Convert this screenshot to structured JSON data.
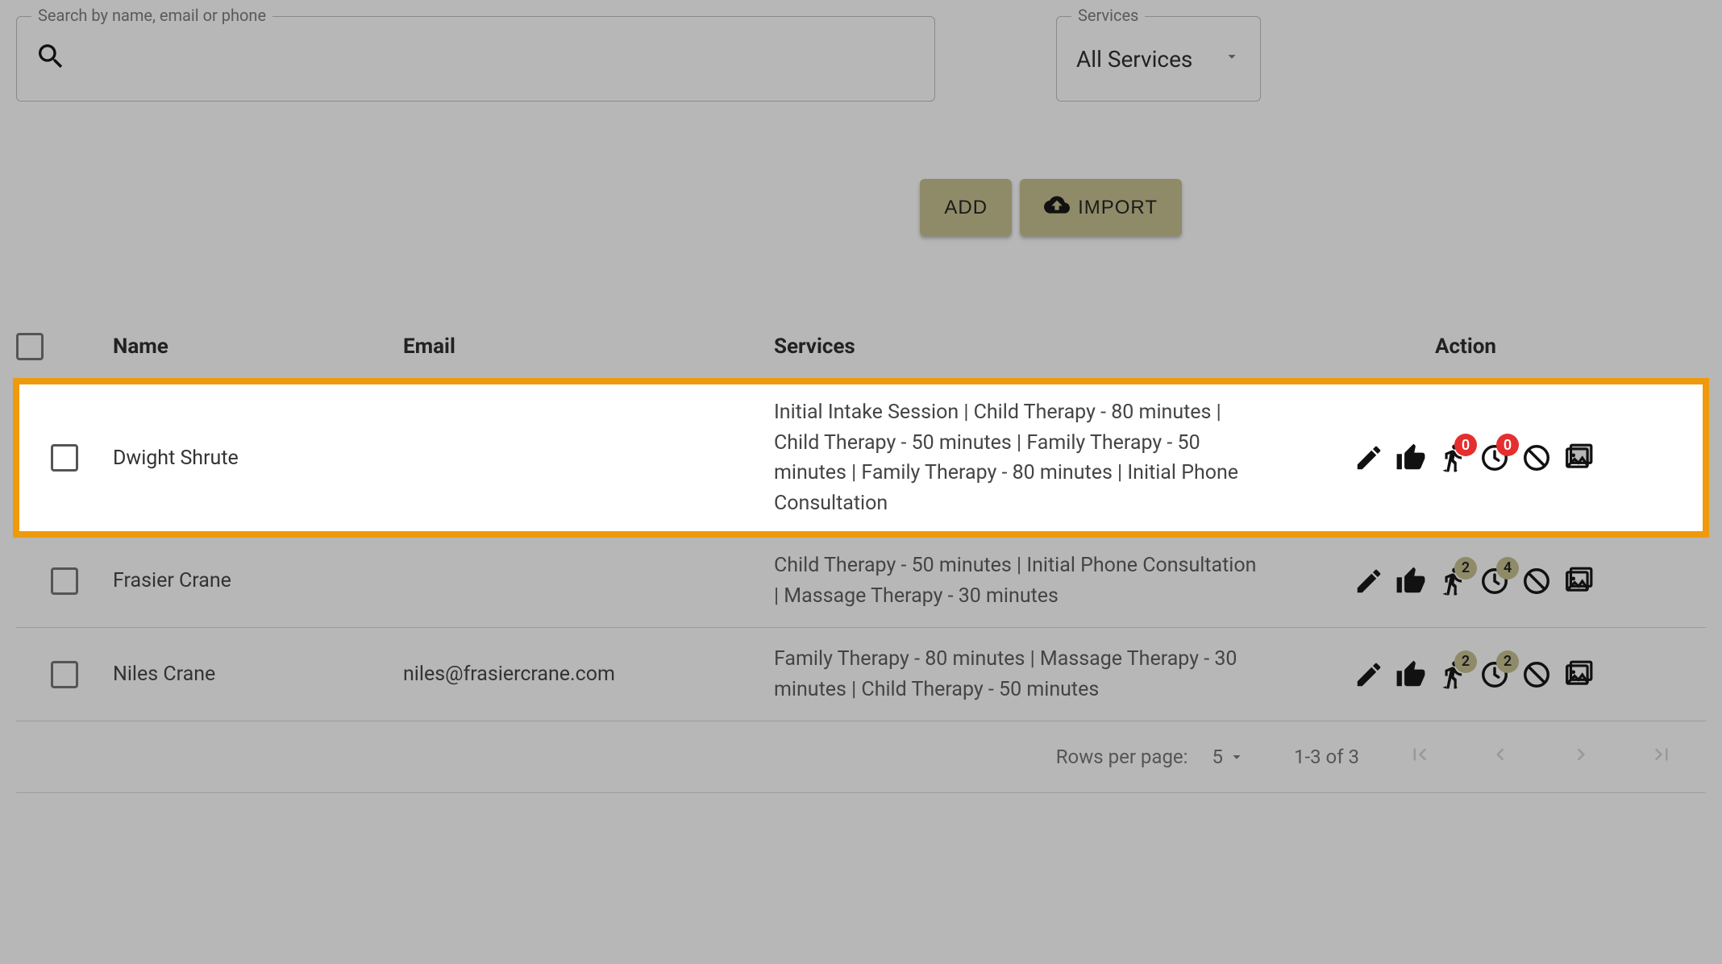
{
  "search": {
    "label": "Search by name, email or phone",
    "value": ""
  },
  "servicesFilter": {
    "label": "Services",
    "value": "All Services"
  },
  "buttons": {
    "add": "ADD",
    "import": "IMPORT"
  },
  "columns": {
    "name": "Name",
    "email": "Email",
    "services": "Services",
    "action": "Action"
  },
  "rows": [
    {
      "name": "Dwight Shrute",
      "email": "",
      "services": "Initial Intake Session | Child Therapy - 80 minutes | Child Therapy - 50 minutes | Family Therapy - 50 minutes | Family Therapy - 80 minutes | Initial Phone Consultation",
      "badge1": "0",
      "badge2": "0",
      "badgeStyle": "red",
      "highlight": true
    },
    {
      "name": "Frasier Crane",
      "email": "",
      "services": "Child Therapy - 50 minutes | Initial Phone Consultation | Massage Therapy - 30 minutes",
      "badge1": "2",
      "badge2": "4",
      "badgeStyle": "olive",
      "highlight": false
    },
    {
      "name": "Niles Crane",
      "email": "niles@frasiercrane.com",
      "services": "Family Therapy - 80 minutes | Massage Therapy - 30 minutes | Child Therapy - 50 minutes",
      "badge1": "2",
      "badge2": "2",
      "badgeStyle": "olive",
      "highlight": false
    }
  ],
  "pager": {
    "rowsPerPageLabel": "Rows per page:",
    "rowsPerPage": "5",
    "range": "1-3 of 3"
  }
}
